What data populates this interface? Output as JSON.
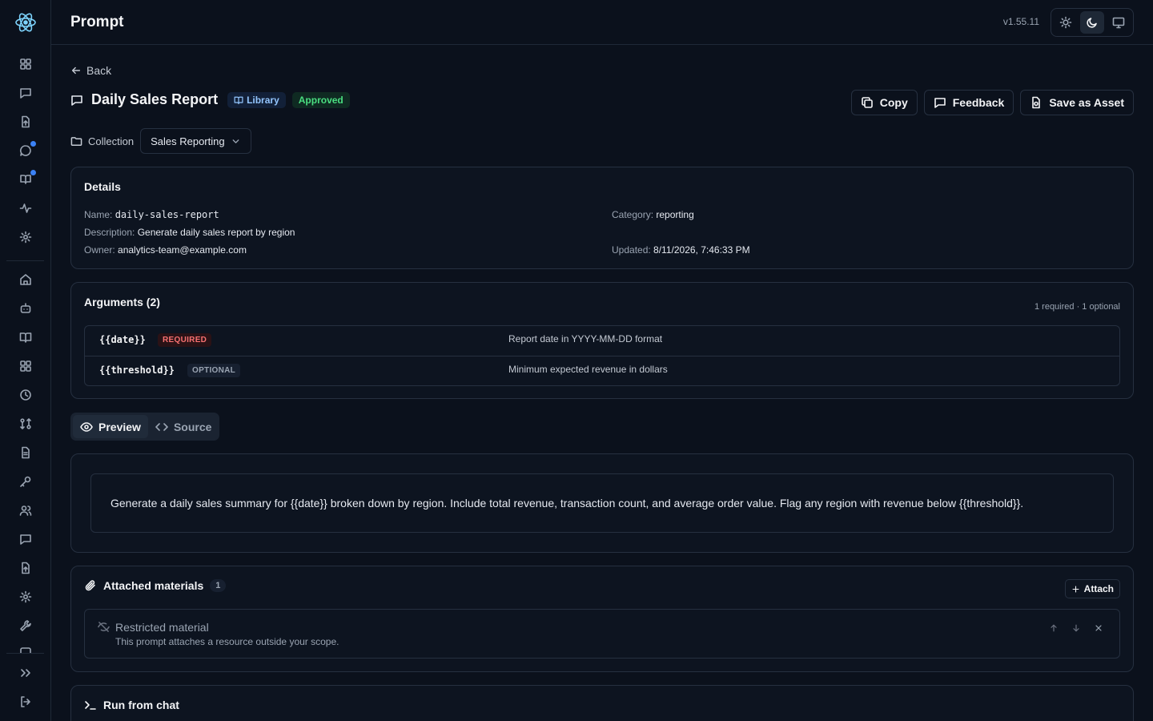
{
  "app": {
    "title": "Prompt",
    "version": "v1.55.11"
  },
  "theme": {
    "options": [
      "light-icon",
      "dark-icon",
      "system-icon"
    ],
    "active": "dark"
  },
  "page": {
    "back_label": "Back",
    "title": "Daily Sales Report",
    "badge_library": "Library",
    "badge_status": "Approved",
    "actions": {
      "copy": "Copy",
      "feedback": "Feedback",
      "save_asset": "Save as Asset"
    },
    "collection": {
      "label": "Collection",
      "value": "Sales Reporting"
    }
  },
  "details": {
    "heading": "Details",
    "name_label": "Name:",
    "name": "daily-sales-report",
    "description_label": "Description:",
    "description": "Generate daily sales report by region",
    "owner_label": "Owner:",
    "owner": "analytics-team@example.com",
    "category_label": "Category:",
    "category": "reporting",
    "updated_label": "Updated:",
    "updated": "8/11/2026, 7:46:33 PM"
  },
  "arguments": {
    "heading": "Arguments (2)",
    "summary": "1 required · 1 optional",
    "items": [
      {
        "name": "{{date}}",
        "tag": "REQUIRED",
        "description": "Report date in YYYY-MM-DD format"
      },
      {
        "name": "{{threshold}}",
        "tag": "OPTIONAL",
        "description": "Minimum expected revenue in dollars"
      }
    ]
  },
  "tabs": {
    "preview": "Preview",
    "source": "Source",
    "active": "preview"
  },
  "preview_text": "Generate a daily sales summary for {{date}} broken down by region. Include total revenue, transaction count, and average order value. Flag any region with revenue below {{threshold}}.",
  "materials": {
    "heading": "Attached materials",
    "count": "1",
    "attach_label": "Attach",
    "items": [
      {
        "title": "Restricted material",
        "subtitle": "This prompt attaches a resource outside your scope."
      }
    ]
  },
  "run": {
    "heading": "Run from chat"
  },
  "colors": {
    "accent": "#3b82f6",
    "required": "#f87171",
    "approved": "#4ade80",
    "library": "#93c5fd"
  }
}
